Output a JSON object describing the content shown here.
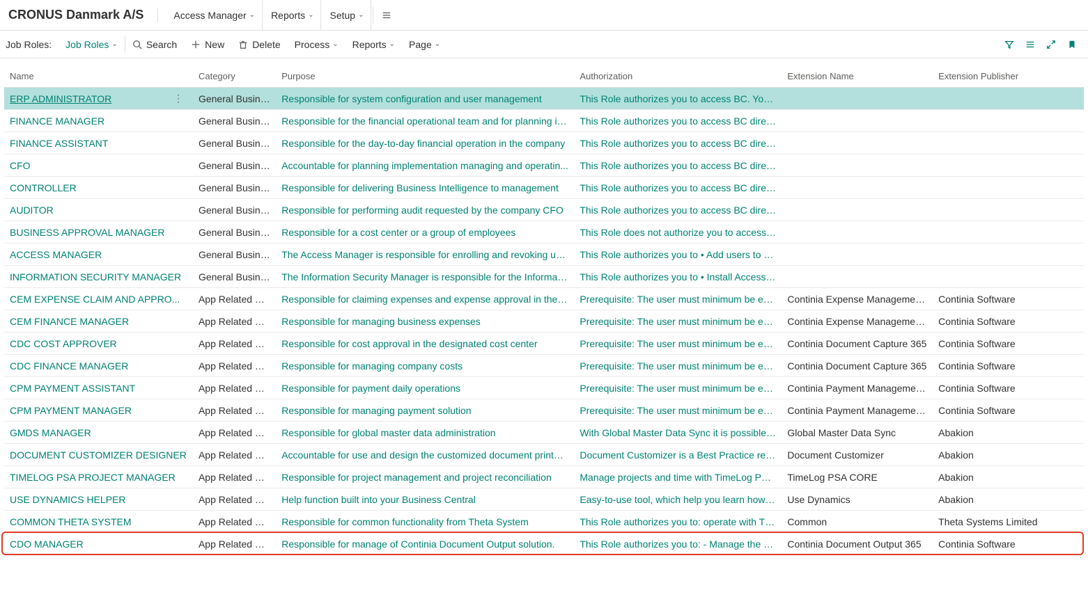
{
  "header": {
    "company": "CRONUS Danmark A/S",
    "menus": [
      "Access Manager",
      "Reports",
      "Setup"
    ]
  },
  "toolbar": {
    "breadcrumb_label": "Job Roles:",
    "view_label": "Job Roles",
    "search": "Search",
    "new": "New",
    "delete": "Delete",
    "process": "Process",
    "reports": "Reports",
    "page": "Page"
  },
  "columns": {
    "name": "Name",
    "category": "Category",
    "purpose": "Purpose",
    "authorization": "Authorization",
    "extension_name": "Extension Name",
    "extension_publisher": "Extension Publisher"
  },
  "rows": [
    {
      "name": "ERP ADMINISTRATOR",
      "category": "General Busines...",
      "purpose": "Responsible for system configuration and user management",
      "authorization": "This Role authorizes you to access BC.  You ha...",
      "extension_name": "",
      "extension_publisher": "",
      "selected": true
    },
    {
      "name": "FINANCE MANAGER",
      "category": "General Busines...",
      "purpose": "Responsible for the financial operational team and for planning im...",
      "authorization": "This Role authorizes you to access BC directly....",
      "extension_name": "",
      "extension_publisher": ""
    },
    {
      "name": "FINANCE ASSISTANT",
      "category": "General Busines...",
      "purpose": "Responsible for the day-to-day financial operation in the company",
      "authorization": "This Role authorizes you to access BC directly....",
      "extension_name": "",
      "extension_publisher": ""
    },
    {
      "name": "CFO",
      "category": "General Busines...",
      "purpose": "Accountable for planning implementation managing and operatin...",
      "authorization": "This Role authorizes you to access BC directly....",
      "extension_name": "",
      "extension_publisher": ""
    },
    {
      "name": "CONTROLLER",
      "category": "General Busines...",
      "purpose": "Responsible for delivering Business Intelligence to management",
      "authorization": "This Role authorizes you to access BC directly....",
      "extension_name": "",
      "extension_publisher": ""
    },
    {
      "name": "AUDITOR",
      "category": "General Busines...",
      "purpose": "Responsible for performing audit requested by the company CFO",
      "authorization": "This Role authorizes you to access BC directly....",
      "extension_name": "",
      "extension_publisher": ""
    },
    {
      "name": "BUSINESS APPROVAL MANAGER",
      "category": "General Busines...",
      "purpose": "Responsible for a cost center or a group of employees",
      "authorization": "This Role does not authorize you to access BC...",
      "extension_name": "",
      "extension_publisher": ""
    },
    {
      "name": "ACCESS MANAGER",
      "category": "General Busines...",
      "purpose": "The Access Manager is responsible for enrolling and revoking user...",
      "authorization": "This Role authorizes you to • Add users to Job...",
      "extension_name": "",
      "extension_publisher": ""
    },
    {
      "name": "INFORMATION SECURITY MANAGER",
      "category": "General Busines...",
      "purpose": "The Information Security Manager is responsible for the Informati...",
      "authorization": "This Role authorizes you to • Install Access M...",
      "extension_name": "",
      "extension_publisher": ""
    },
    {
      "name": "CEM EXPENSE CLAIM AND APPRO...",
      "category": "App Related Role",
      "purpose": "Responsible for claiming expenses and expense approval in the de...",
      "authorization": "Prerequisite: The user must minimum be enrol...",
      "extension_name": "Continia Expense Management ...",
      "extension_publisher": "Continia Software"
    },
    {
      "name": "CEM FINANCE MANAGER",
      "category": "App Related Role",
      "purpose": "Responsible for managing business expenses",
      "authorization": "Prerequisite: The user must minimum be enrol...",
      "extension_name": "Continia Expense Management ...",
      "extension_publisher": "Continia Software"
    },
    {
      "name": "CDC COST APPROVER",
      "category": "App Related Role",
      "purpose": "Responsible for cost approval in the designated cost center",
      "authorization": "Prerequisite: The user must minimum be enrol...",
      "extension_name": "Continia Document Capture 365",
      "extension_publisher": "Continia Software"
    },
    {
      "name": "CDC FINANCE MANAGER",
      "category": "App Related Role",
      "purpose": "Responsible for managing company costs",
      "authorization": "Prerequisite: The user must minimum be enrol...",
      "extension_name": "Continia Document Capture 365",
      "extension_publisher": "Continia Software"
    },
    {
      "name": "CPM PAYMENT ASSISTANT",
      "category": "App Related Role",
      "purpose": "Responsible for payment daily operations",
      "authorization": "Prerequisite: The user must minimum be enrol...",
      "extension_name": "Continia Payment Management...",
      "extension_publisher": "Continia Software"
    },
    {
      "name": "CPM PAYMENT MANAGER",
      "category": "App Related Role",
      "purpose": "Responsible for managing payment solution",
      "authorization": "Prerequisite: The user must minimum be enrol...",
      "extension_name": "Continia Payment Management...",
      "extension_publisher": "Continia Software"
    },
    {
      "name": "GMDS MANAGER",
      "category": "App Related Role",
      "purpose": "Responsible for global master data administration",
      "authorization": "With Global Master Data Sync it is possible to...",
      "extension_name": "Global Master Data Sync",
      "extension_publisher": "Abakion"
    },
    {
      "name": "DOCUMENT CUSTOMIZER DESIGNER",
      "category": "App Related Role",
      "purpose": "Accountable for use and design the customized document printouts",
      "authorization": "Document Customizer is a Best Practice repor...",
      "extension_name": "Document Customizer",
      "extension_publisher": "Abakion"
    },
    {
      "name": "TIMELOG PSA PROJECT MANAGER",
      "category": "App Related Role",
      "purpose": "Responsible for project management and project reconciliation",
      "authorization": "Manage projects and time with TimeLog PSA, ...",
      "extension_name": "TimeLog PSA CORE",
      "extension_publisher": "Abakion"
    },
    {
      "name": "USE DYNAMICS HELPER",
      "category": "App Related Role",
      "purpose": "Help function built into your Business Central",
      "authorization": "Easy-to-use tool, which help you learn how to...",
      "extension_name": "Use Dynamics",
      "extension_publisher": "Abakion"
    },
    {
      "name": "COMMON THETA SYSTEM",
      "category": "App Related Role",
      "purpose": "Responsible for common functionality from Theta System",
      "authorization": "This Role authorizes you to: operate with Thet...",
      "extension_name": "Common",
      "extension_publisher": "Theta Systems Limited"
    },
    {
      "name": "CDO MANAGER",
      "category": "App Related Role",
      "purpose": "Responsible for manage of Continia Document Output solution.",
      "authorization": "This Role authorizes you to: - Manage the set...",
      "extension_name": "Continia Document Output 365",
      "extension_publisher": "Continia Software",
      "highlight": true
    }
  ]
}
